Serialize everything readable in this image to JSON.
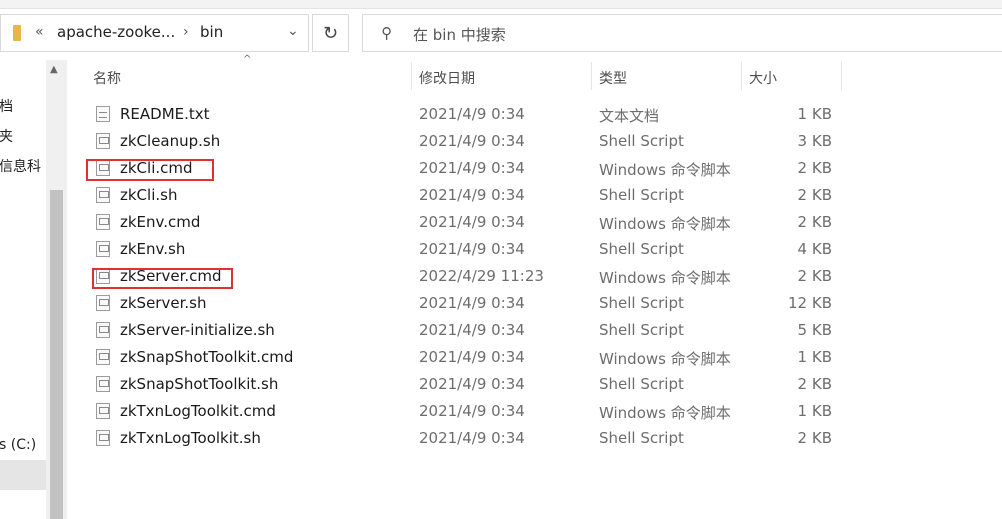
{
  "address": {
    "collapse_glyph": "«",
    "crumbs": [
      "apache-zooke...",
      "bin"
    ],
    "separator_glyph": "›",
    "dropdown_glyph": "⌄"
  },
  "refresh_glyph": "↻",
  "search": {
    "placeholder": "在 bin 中搜索",
    "icon_glyph": "⚲"
  },
  "nav": {
    "items": [
      "档",
      "夹",
      "信息科",
      "s (C:)"
    ]
  },
  "columns": {
    "name": "名称",
    "date": "修改日期",
    "type": "类型",
    "size": "大小",
    "sort_glyph": "^"
  },
  "files": [
    {
      "name": "README.txt",
      "date": "2021/4/9 0:34",
      "type": "文本文档",
      "size": "1 KB",
      "icon": "text-file-icon"
    },
    {
      "name": "zkCleanup.sh",
      "date": "2021/4/9 0:34",
      "type": "Shell Script",
      "size": "3 KB",
      "icon": "script-file-icon"
    },
    {
      "name": "zkCli.cmd",
      "date": "2021/4/9 0:34",
      "type": "Windows 命令脚本",
      "size": "2 KB",
      "icon": "script-file-icon"
    },
    {
      "name": "zkCli.sh",
      "date": "2021/4/9 0:34",
      "type": "Shell Script",
      "size": "2 KB",
      "icon": "script-file-icon"
    },
    {
      "name": "zkEnv.cmd",
      "date": "2021/4/9 0:34",
      "type": "Windows 命令脚本",
      "size": "2 KB",
      "icon": "script-file-icon"
    },
    {
      "name": "zkEnv.sh",
      "date": "2021/4/9 0:34",
      "type": "Shell Script",
      "size": "4 KB",
      "icon": "script-file-icon"
    },
    {
      "name": "zkServer.cmd",
      "date": "2022/4/29 11:23",
      "type": "Windows 命令脚本",
      "size": "2 KB",
      "icon": "script-file-icon"
    },
    {
      "name": "zkServer.sh",
      "date": "2021/4/9 0:34",
      "type": "Shell Script",
      "size": "12 KB",
      "icon": "script-file-icon"
    },
    {
      "name": "zkServer-initialize.sh",
      "date": "2021/4/9 0:34",
      "type": "Shell Script",
      "size": "5 KB",
      "icon": "script-file-icon"
    },
    {
      "name": "zkSnapShotToolkit.cmd",
      "date": "2021/4/9 0:34",
      "type": "Windows 命令脚本",
      "size": "1 KB",
      "icon": "script-file-icon"
    },
    {
      "name": "zkSnapShotToolkit.sh",
      "date": "2021/4/9 0:34",
      "type": "Shell Script",
      "size": "2 KB",
      "icon": "script-file-icon"
    },
    {
      "name": "zkTxnLogToolkit.cmd",
      "date": "2021/4/9 0:34",
      "type": "Windows 命令脚本",
      "size": "1 KB",
      "icon": "script-file-icon"
    },
    {
      "name": "zkTxnLogToolkit.sh",
      "date": "2021/4/9 0:34",
      "type": "Shell Script",
      "size": "2 KB",
      "icon": "script-file-icon"
    }
  ],
  "highlight_color": "#e03030"
}
